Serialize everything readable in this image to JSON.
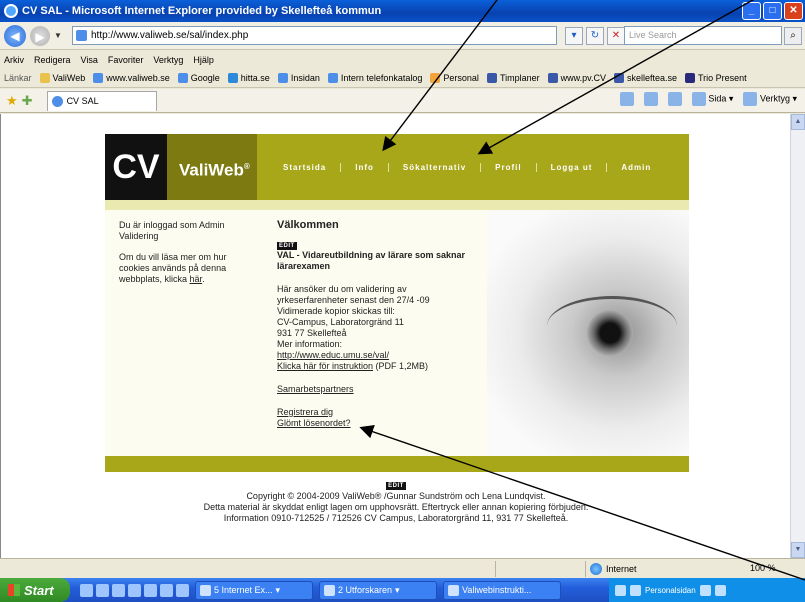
{
  "window": {
    "title": "CV SAL - Microsoft Internet Explorer provided by Skellefteå kommun"
  },
  "address_bar": {
    "url": "http://www.valiweb.se/sal/index.php",
    "search_placeholder": "Live Search"
  },
  "menu": [
    "Arkiv",
    "Redigera",
    "Visa",
    "Favoriter",
    "Verktyg",
    "Hjälp"
  ],
  "links_bar": {
    "label": "Länkar",
    "items": [
      "ValiWeb",
      "www.valiweb.se",
      "Google",
      "hitta.se",
      "Insidan",
      "Intern telefonkatalog",
      "Personal",
      "Timplaner",
      "www.pv.CV",
      "skelleftea.se",
      "Trio Present"
    ]
  },
  "tab": {
    "title": "CV SAL"
  },
  "command_bar": [
    "Sida",
    "Verktyg"
  ],
  "site": {
    "logo_cv": "CV",
    "logo_valiweb": "ValiWeb",
    "logo_reg": "®",
    "nav": [
      "Startsida",
      "Info",
      "Sökalternativ",
      "Profil",
      "Logga ut",
      "Admin"
    ],
    "sidebar": {
      "logged_in": "Du är inloggad som Admin Validering",
      "cookies_text": "Om du vill läsa mer om hur cookies används på denna webbplats, klicka ",
      "cookies_link": "här",
      "cookies_end": "."
    },
    "main": {
      "heading": "Välkommen",
      "edit_badge": "EDIT",
      "subtitle": "VAL - Vidareutbildning av lärare som saknar lärarexamen",
      "lines": [
        "Här ansöker du om validering av",
        "yrkeserfarenheter senast den 27/4 -09",
        "Vidimerade kopior skickas till:",
        "CV-Campus, Laboratorgränd 11",
        "931 77 Skellefteå",
        "Mer information:"
      ],
      "info_link": "http://www.educ.umu.se/val/",
      "instruction_link": "Klicka här för instruktion",
      "instruction_suffix": " (PDF 1,2MB)",
      "partners_link": "Samarbetspartners",
      "register_link": "Registrera dig",
      "forgot_link": "Glömt lösenordet?"
    },
    "footer": {
      "edit_badge": "EDIT",
      "line1": "Copyright © 2004-2009 ValiWeb® /Gunnar Sundström och Lena Lundqvist.",
      "line2": "Detta material är skyddat enligt lagen om upphovsrätt. Eftertryck eller annan kopiering förbjuden.",
      "line3": "Information 0910-712525 / 712526 CV Campus, Laboratorgränd 11, 931 77 Skellefteå."
    }
  },
  "status_bar": {
    "zone": "Internet",
    "zoom": "100 %"
  },
  "taskbar": {
    "start": "Start",
    "tasks": [
      "5 Internet Ex...",
      "2 Utforskaren",
      "Valiwebinstrukti..."
    ],
    "tray_text": "Personalsidan"
  }
}
